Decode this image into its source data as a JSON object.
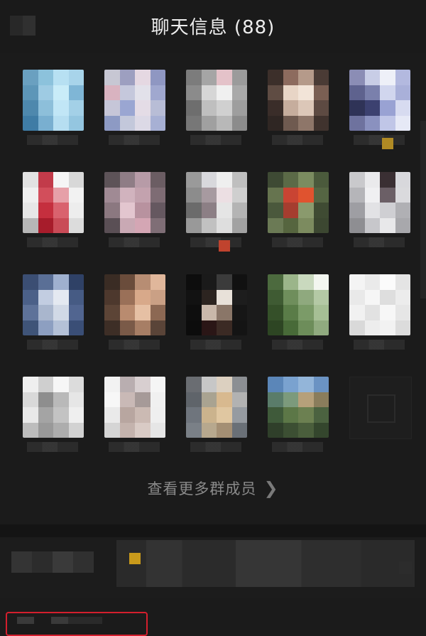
{
  "header": {
    "title": "聊天信息 (88)"
  },
  "members": [
    {
      "colors": [
        "#6aa0c0",
        "#8cc2dc",
        "#b7e0f2",
        "#a8d4ea",
        "#5d96b8",
        "#9ecbe3",
        "#c9ecf8",
        "#7fb6d6",
        "#4e88ad",
        "#8dbfda",
        "#c1e6f6",
        "#a3d0e7",
        "#3f7ca5",
        "#79afd0",
        "#b6def1",
        "#94c6e0"
      ]
    },
    {
      "colors": [
        "#c7c7d3",
        "#9d9fc0",
        "#e5d8e2",
        "#8f97c2",
        "#d9b3c0",
        "#c5c8dc",
        "#e2e1ea",
        "#a0a8cf",
        "#c6c6d8",
        "#9aa6d2",
        "#e4dce6",
        "#b8bdd6",
        "#8d9ac4",
        "#c3c8db",
        "#dcd9e6",
        "#a7b0d4"
      ]
    },
    {
      "colors": [
        "#7c7c7c",
        "#a5a5a5",
        "#e4c2c9",
        "#9b9b9b",
        "#8b8b8b",
        "#d6d6d6",
        "#f0f0f0",
        "#a9a9a9",
        "#6e6e6e",
        "#bfbfbf",
        "#d0d0d0",
        "#9e9e9e",
        "#777777",
        "#a0a0a0",
        "#b8b8b8",
        "#8c8c8c"
      ]
    },
    {
      "colors": [
        "#3c2f2a",
        "#8d6b5e",
        "#b59a8a",
        "#4a3b35",
        "#5f4c43",
        "#e8d5c6",
        "#f2e4d8",
        "#7a5f53",
        "#3a2d29",
        "#c6ad9d",
        "#dcc7b8",
        "#5d4a42",
        "#2f2623",
        "#6f5a50",
        "#8e7669",
        "#40332e"
      ]
    },
    {
      "colors": [
        "#8b8db5",
        "#c8cde6",
        "#eef0f8",
        "#b3b9df",
        "#5e628e",
        "#7a80ac",
        "#d1d6ee",
        "#a9b0d9",
        "#2f3357",
        "#3c4170",
        "#99a2d3",
        "#d7dbf0",
        "#6e729e",
        "#8a91bf",
        "#c0c6e7",
        "#e6e9f6"
      ]
    },
    {
      "colors": [
        "#e2e2e2",
        "#c23b4a",
        "#f5f5f5",
        "#d8d8d8",
        "#f0f0f0",
        "#d24e5b",
        "#e6a0a8",
        "#f2f2f2",
        "#e7e7e7",
        "#c52f3e",
        "#d9626e",
        "#ededed",
        "#b7b7b7",
        "#a71c2b",
        "#c94b57",
        "#dcdcdc"
      ]
    },
    {
      "colors": [
        "#5d5358",
        "#8f7d86",
        "#b79ba7",
        "#6b5d63",
        "#a08a94",
        "#d1b3be",
        "#c3a2ae",
        "#7e6c74",
        "#8b7880",
        "#e3c6cf",
        "#b8929f",
        "#655860",
        "#5a4f55",
        "#c9a9b4",
        "#d4a6b4",
        "#7f6e76"
      ]
    },
    {
      "colors": [
        "#9a9a9a",
        "#d8d8dc",
        "#efefef",
        "#bfbfbf",
        "#8c8c8c",
        "#a79aa0",
        "#ecdfe3",
        "#cfcfcf",
        "#6b6b6b",
        "#8c7f85",
        "#e5e5e5",
        "#b4b4b4",
        "#999999",
        "#c1c1c1",
        "#dedede",
        "#a2a2a2"
      ]
    },
    {
      "colors": [
        "#3e4a34",
        "#5b6a47",
        "#7b8c60",
        "#4b5a3c",
        "#66744f",
        "#c94433",
        "#e0532f",
        "#556543",
        "#4a583c",
        "#a53d2f",
        "#8a9a6d",
        "#3f4b33",
        "#6b7a55",
        "#56653f",
        "#7c8b5f",
        "#3c4731"
      ]
    },
    {
      "colors": [
        "#c9c9cc",
        "#eaeaec",
        "#3a2f33",
        "#d8d8dc",
        "#b5b5b9",
        "#f0f0f2",
        "#6b5f66",
        "#dadadd",
        "#9e9ea3",
        "#e2e2e5",
        "#cfcfd3",
        "#b0b0b4",
        "#8e8e92",
        "#c7c7cb",
        "#e8e8ea",
        "#a8a8ac"
      ]
    },
    {
      "colors": [
        "#3b4e73",
        "#5a6f96",
        "#9fb0cf",
        "#2f4166",
        "#4b6088",
        "#c2cde1",
        "#e4e9f1",
        "#465b84",
        "#5e7299",
        "#a9b6cd",
        "#d1d9e6",
        "#516590",
        "#3f5478",
        "#8d9fc1",
        "#b4c1d7",
        "#3a4e76"
      ]
    },
    {
      "colors": [
        "#3a2c24",
        "#6a4c3b",
        "#b78d73",
        "#e0b79b",
        "#4d382d",
        "#9a7058",
        "#d8a98a",
        "#caa085",
        "#5c4436",
        "#b98b6f",
        "#e6c0a4",
        "#8c6853",
        "#3d2e26",
        "#7a5a48",
        "#a77e65",
        "#5a4438"
      ]
    },
    {
      "colors": [
        "#0d0d0d",
        "#1a1a1a",
        "#3b3b3b",
        "#111111",
        "#121212",
        "#2c2420",
        "#e8e1d9",
        "#1d1d1d",
        "#0e0e0e",
        "#c9b8aa",
        "#8a7668",
        "#161616",
        "#0c0c0c",
        "#2a1616",
        "#3b2a24",
        "#141414"
      ]
    },
    {
      "colors": [
        "#4c6a3e",
        "#9bb58a",
        "#c9d9be",
        "#f3f6f0",
        "#3f5b33",
        "#6f8e5c",
        "#8fa97e",
        "#b4c9a5",
        "#355029",
        "#5a7c48",
        "#7b9b68",
        "#a6bf95",
        "#2d4523",
        "#486a38",
        "#6d8d5a",
        "#90aa7f"
      ]
    },
    {
      "colors": [
        "#f4f4f4",
        "#eaeaea",
        "#fbfbfb",
        "#e4e4e4",
        "#e9e9e9",
        "#f6f6f6",
        "#dedede",
        "#ececec",
        "#f1f1f1",
        "#e2e2e2",
        "#f7f7f7",
        "#e6e6e6",
        "#d9d9d9",
        "#ededed",
        "#f2f2f2",
        "#dcdcdc"
      ]
    },
    {
      "colors": [
        "#efefef",
        "#cfcfcf",
        "#f6f6f6",
        "#dcdcdc",
        "#d9d9d9",
        "#8e8e8e",
        "#b9b9b9",
        "#e6e6e6",
        "#e9e9e9",
        "#a4a4a4",
        "#c3c3c3",
        "#efefef",
        "#bdbdbd",
        "#999999",
        "#adadad",
        "#d2d2d2"
      ]
    },
    {
      "colors": [
        "#f2f2f2",
        "#b9aeb0",
        "#d8cfd0",
        "#f5f5f5",
        "#f7f7f7",
        "#c9b9b6",
        "#a69a98",
        "#f0f0f0",
        "#eaeaea",
        "#b8a6a0",
        "#cbbab3",
        "#efefef",
        "#d5d5d5",
        "#c4b3ad",
        "#d9cbc5",
        "#e6e6e6"
      ]
    },
    {
      "colors": [
        "#6a6d72",
        "#c7c7c7",
        "#dcd0c0",
        "#8c8f93",
        "#5f646a",
        "#a9a391",
        "#d8b98f",
        "#b2b2b2",
        "#6f757d",
        "#cbb38d",
        "#e0c7a1",
        "#969ba1",
        "#7a8087",
        "#b7a88e",
        "#a48f74",
        "#6a7077"
      ]
    },
    {
      "colors": [
        "#5b86b8",
        "#7aa2cf",
        "#93b5d9",
        "#6b93c3",
        "#5a7c6a",
        "#7c9a7c",
        "#b6a07a",
        "#8a7d5c",
        "#3f5a3a",
        "#5c7747",
        "#6c8051",
        "#4b6240",
        "#2f3f2a",
        "#3c4f33",
        "#4a5e3c",
        "#34462d"
      ]
    }
  ],
  "badges": [
    {
      "member": 4,
      "color": "#b08a24"
    },
    {
      "member": 7,
      "color": "#c0432e"
    }
  ],
  "more_members_label": "查看更多群成员"
}
